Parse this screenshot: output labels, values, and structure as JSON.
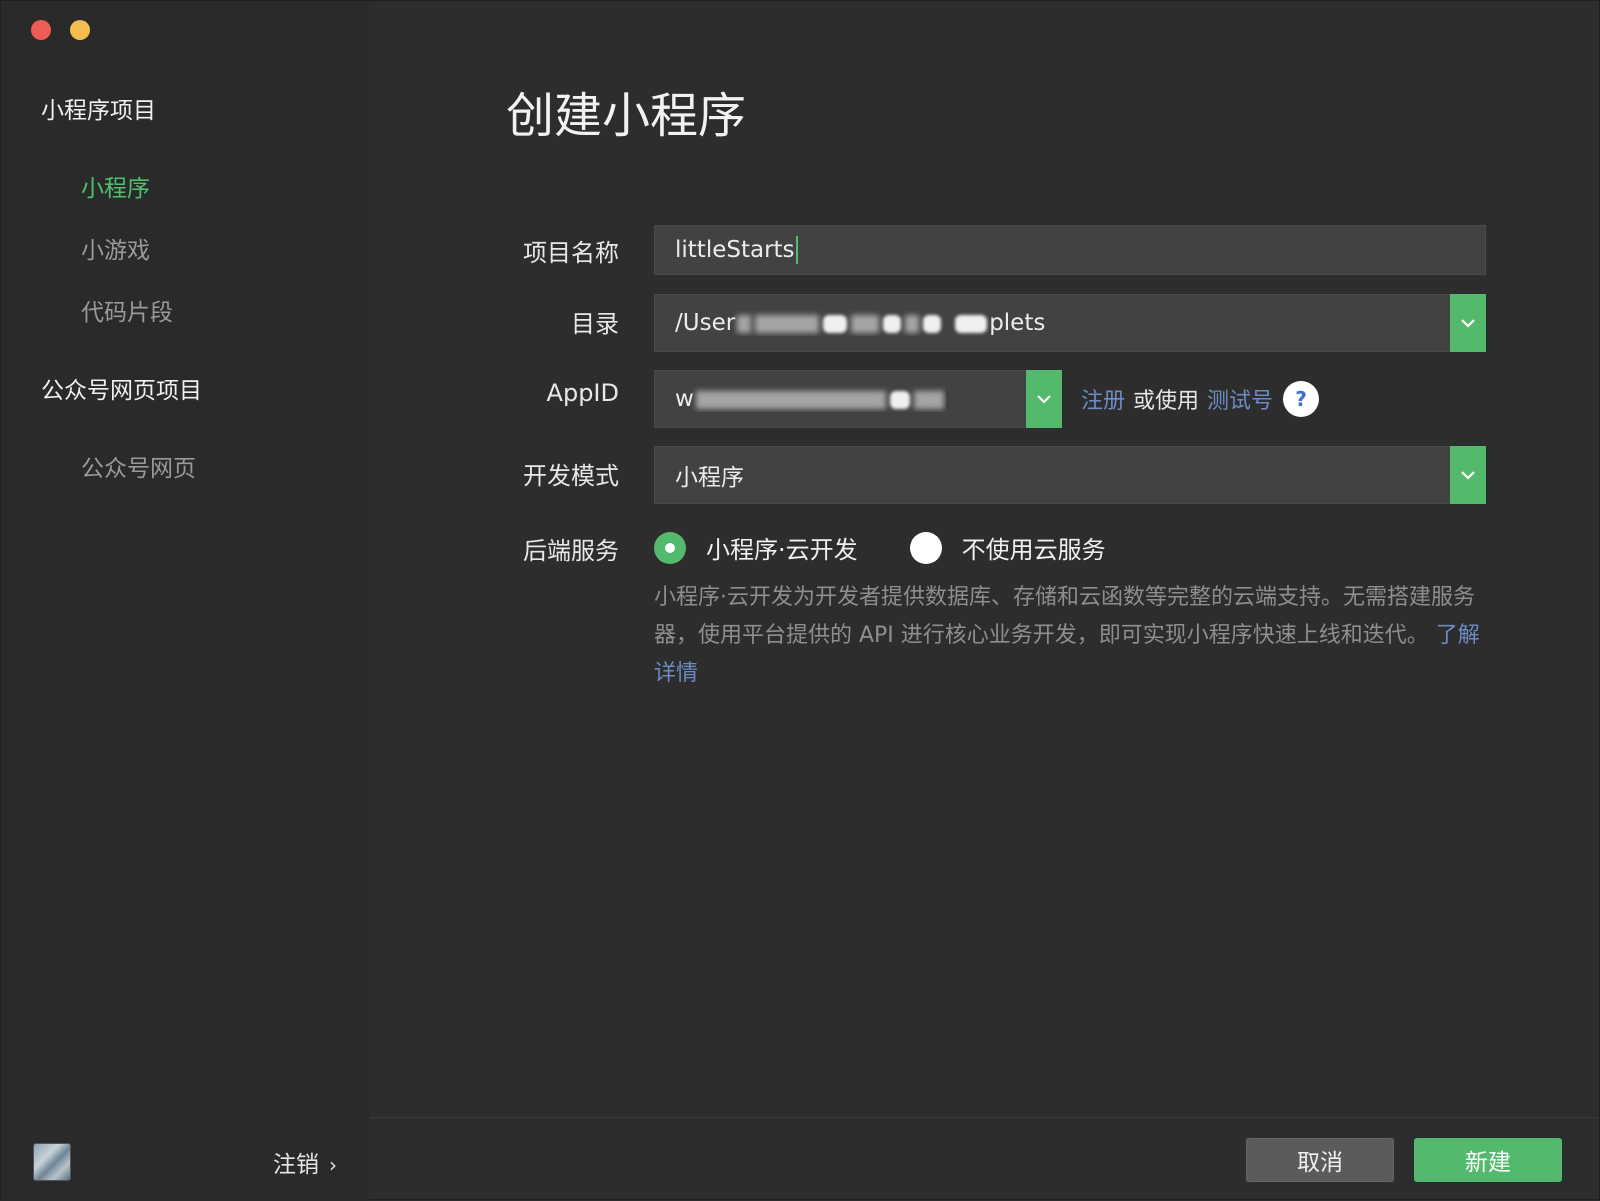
{
  "sidebar": {
    "section1_title": "小程序项目",
    "section1_items": [
      "小程序",
      "小游戏",
      "代码片段"
    ],
    "active_item": "小程序",
    "section2_title": "公众号网页项目",
    "section2_items": [
      "公众号网页"
    ],
    "logout_label": "注销",
    "logout_icon": "chevron-right-icon"
  },
  "main": {
    "title": "创建小程序",
    "form": {
      "project_name_label": "项目名称",
      "project_name_value": "littleStarts",
      "directory_label": "目录",
      "directory_value_start": "/User",
      "directory_value_end": "plets",
      "appid_label": "AppID",
      "appid_value_start": "w",
      "register_link": "注册",
      "or_use_text": "或使用",
      "test_account_link": "测试号",
      "help_icon_text": "?",
      "dev_mode_label": "开发模式",
      "dev_mode_value": "小程序",
      "backend_label": "后端服务",
      "backend_option1": "小程序·云开发",
      "backend_option2": "不使用云服务",
      "backend_selected": "小程序·云开发",
      "description": "小程序·云开发为开发者提供数据库、存储和云函数等完整的云端支持。无需搭建服务器，使用平台提供的 API 进行核心业务开发，即可实现小程序快速上线和迭代。",
      "learn_more_link": "了解详情"
    },
    "buttons": {
      "cancel": "取消",
      "create": "新建"
    }
  },
  "colors": {
    "accent_green": "#53b96c",
    "link_blue": "#6b8cc4",
    "background": "#2d2d2d"
  }
}
